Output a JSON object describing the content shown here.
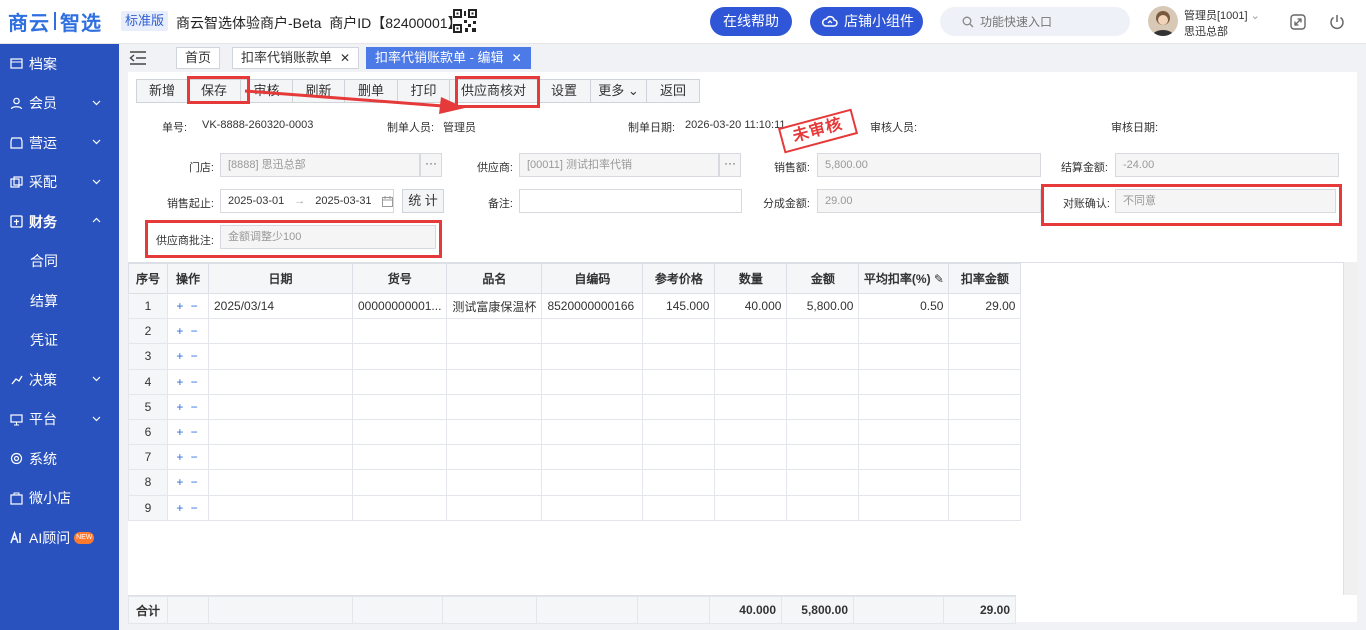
{
  "header": {
    "logo_part1": "商云",
    "logo_part2": "智选",
    "edition": "标准版",
    "company": "商云智选体验商户-Beta  商户ID【82400001】",
    "help_button": "在线帮助",
    "widget_button": "店铺小组件",
    "search_placeholder": "功能快速入口",
    "user_name": "管理员[1001]",
    "user_dept": "思迅总部"
  },
  "sidebar": {
    "items": [
      {
        "label": "档案",
        "icon": "archive-icon"
      },
      {
        "label": "会员",
        "icon": "member-icon"
      },
      {
        "label": "营运",
        "icon": "store-icon"
      },
      {
        "label": "采配",
        "icon": "purchase-icon"
      },
      {
        "label": "财务",
        "icon": "finance-icon"
      },
      {
        "label": "合同"
      },
      {
        "label": "结算"
      },
      {
        "label": "凭证"
      },
      {
        "label": "决策",
        "icon": "decision-icon"
      },
      {
        "label": "平台",
        "icon": "platform-icon"
      },
      {
        "label": "系统",
        "icon": "system-icon"
      },
      {
        "label": "微小店",
        "icon": "shop-icon"
      },
      {
        "label": "AI顾问",
        "icon": "ai-icon"
      }
    ],
    "new_badge": "NEW"
  },
  "tabs": [
    {
      "label": "首页"
    },
    {
      "label": "扣率代销账款单"
    },
    {
      "label": "扣率代销账款单 - 编辑"
    }
  ],
  "toolbar": {
    "buttons": [
      "新增",
      "保存",
      "审核",
      "刷新",
      "删单",
      "打印",
      "供应商核对",
      "设置",
      "更多",
      "返回"
    ]
  },
  "meta": {
    "order_label": "单号:",
    "order_no": "VK-8888-260320-0003",
    "creator_label": "制单人员:",
    "creator": "管理员",
    "date_label": "制单日期:",
    "date": "2026-03-20 11:10:11",
    "reviewer_label": "审核人员:",
    "review_date_label": "审核日期:",
    "stamp": "未审核"
  },
  "form": {
    "store_label": "门店:",
    "store_value": "[8888]    思迅总部",
    "supplier_label": "供应商:",
    "supplier_value": "[00011]    测试扣率代销",
    "sales_label": "销售额:",
    "sales_value": "5,800.00",
    "settle_label": "结算金额:",
    "settle_value": "-24.00",
    "period_label": "销售起止:",
    "period_from": "2025-03-01",
    "period_to": "2025-03-31",
    "stat_button": "统 计",
    "remark_label": "备注:",
    "remark_value": "",
    "share_label": "分成金额:",
    "share_value": "29.00",
    "confirm_label": "对账确认:",
    "confirm_value": "不同意",
    "approval_label": "供应商批注:",
    "approval_value": "金额调整少100"
  },
  "table": {
    "columns": [
      "序号",
      "操作",
      "日期",
      "货号",
      "品名",
      "自编码",
      "参考价格",
      "数量",
      "金额",
      "平均扣率(%)",
      "扣率金额"
    ],
    "rows": [
      {
        "idx": "1",
        "ops": "+ −",
        "date": "2025/03/14",
        "code": "00000000001...",
        "name": "测试富康保温杯",
        "selfcode": "8520000000166",
        "price": "145.000",
        "qty": "40.000",
        "amount": "5,800.00",
        "rate": "0.50",
        "rate_amount": "29.00"
      },
      {
        "idx": "2",
        "ops": "+ −",
        "date": "",
        "code": "",
        "name": "",
        "selfcode": "",
        "price": "",
        "qty": "",
        "amount": "",
        "rate": "",
        "rate_amount": ""
      },
      {
        "idx": "3",
        "ops": "+ −",
        "date": "",
        "code": "",
        "name": "",
        "selfcode": "",
        "price": "",
        "qty": "",
        "amount": "",
        "rate": "",
        "rate_amount": ""
      },
      {
        "idx": "4",
        "ops": "+ −",
        "date": "",
        "code": "",
        "name": "",
        "selfcode": "",
        "price": "",
        "qty": "",
        "amount": "",
        "rate": "",
        "rate_amount": ""
      },
      {
        "idx": "5",
        "ops": "+ −",
        "date": "",
        "code": "",
        "name": "",
        "selfcode": "",
        "price": "",
        "qty": "",
        "amount": "",
        "rate": "",
        "rate_amount": ""
      },
      {
        "idx": "6",
        "ops": "+ −",
        "date": "",
        "code": "",
        "name": "",
        "selfcode": "",
        "price": "",
        "qty": "",
        "amount": "",
        "rate": "",
        "rate_amount": ""
      },
      {
        "idx": "7",
        "ops": "+ −",
        "date": "",
        "code": "",
        "name": "",
        "selfcode": "",
        "price": "",
        "qty": "",
        "amount": "",
        "rate": "",
        "rate_amount": ""
      },
      {
        "idx": "8",
        "ops": "+ −",
        "date": "",
        "code": "",
        "name": "",
        "selfcode": "",
        "price": "",
        "qty": "",
        "amount": "",
        "rate": "",
        "rate_amount": ""
      },
      {
        "idx": "9",
        "ops": "+ −",
        "date": "",
        "code": "",
        "name": "",
        "selfcode": "",
        "price": "",
        "qty": "",
        "amount": "",
        "rate": "",
        "rate_amount": ""
      }
    ],
    "footer": {
      "label": "合计",
      "qty": "40.000",
      "amount": "5,800.00",
      "rate_amount": "29.00"
    }
  },
  "colors": {
    "sidebar": "#2a52be",
    "accent": "#2f56d6",
    "highlight": "#e6393a"
  }
}
